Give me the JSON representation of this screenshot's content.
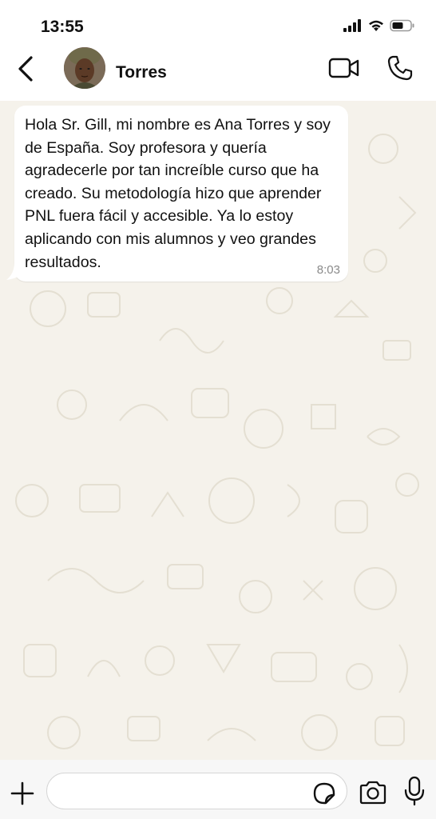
{
  "status_bar": {
    "time": "13:55",
    "icons": [
      "cellular-signal-icon",
      "wifi-icon",
      "battery-icon"
    ]
  },
  "header": {
    "back_icon": "chevron-left-icon",
    "contact_name": "Torres",
    "video_call_icon": "video-camera-icon",
    "voice_call_icon": "phone-icon"
  },
  "messages": [
    {
      "text": "Hola Sr. Gill, mi nombre es Ana Torres y soy de España. Soy profesora y quería agradecerle por tan increíble curso que ha creado. Su metodología hizo que aprender PNL fuera fácil y accesible. Ya lo estoy aplicando con mis alumnos y veo grandes resultados.",
      "time": "8:03",
      "direction": "incoming"
    }
  ],
  "input_bar": {
    "placeholder": "",
    "value": "",
    "icons": [
      "plus-icon",
      "sticker-icon",
      "camera-icon",
      "microphone-icon"
    ]
  },
  "colors": {
    "chat_background": "#f5f2eb",
    "bubble_incoming": "#ffffff",
    "header_background": "#ffffff",
    "text": "#111111",
    "timestamp": "#8a8a8a"
  }
}
